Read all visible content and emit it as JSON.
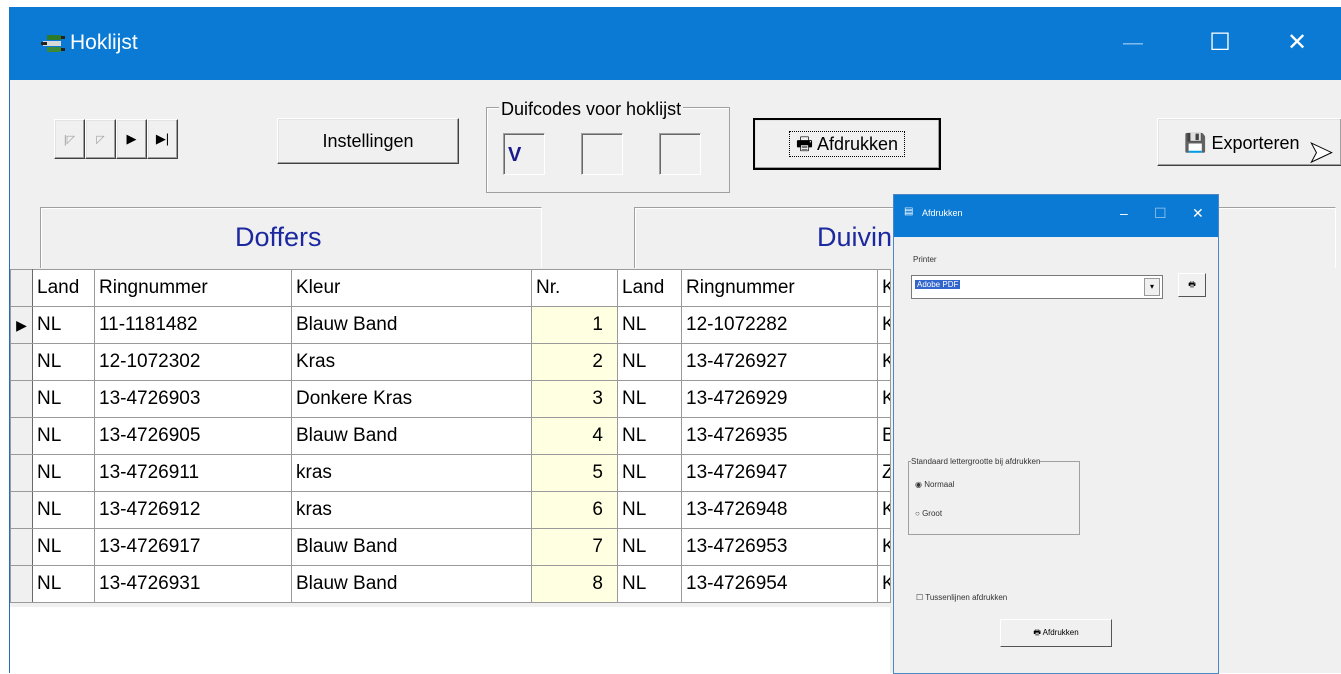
{
  "window": {
    "title": "Hoklijst",
    "controls": {
      "minimize": "—",
      "maximize": "☐",
      "close": "✕"
    }
  },
  "toolbar": {
    "nav_first": "⏮",
    "nav_prev": "◀",
    "nav_next": "▶",
    "nav_last": "▶|",
    "instellingen_label": "Instellingen",
    "afdrukken_label": "Afdrukken",
    "exporteren_label": "Exporteren"
  },
  "duifcodes": {
    "legend": "Duifcodes voor hoklijst",
    "codes": [
      "V",
      "",
      ""
    ]
  },
  "panels": {
    "doffers": "Doffers",
    "duivinnen": "Duivinn"
  },
  "table": {
    "headers": [
      "Land",
      "Ringnummer",
      "Kleur",
      "Nr.",
      "Land",
      "Ringnummer",
      "K"
    ],
    "rows": [
      {
        "land1": "NL",
        "ring1": "11-1181482",
        "kleur1": "Blauw Band",
        "nr": "1",
        "land2": "NL",
        "ring2": "12-1072282",
        "k2": "K"
      },
      {
        "land1": "NL",
        "ring1": "12-1072302",
        "kleur1": "Kras",
        "nr": "2",
        "land2": "NL",
        "ring2": "13-4726927",
        "k2": "K"
      },
      {
        "land1": "NL",
        "ring1": "13-4726903",
        "kleur1": "Donkere Kras",
        "nr": "3",
        "land2": "NL",
        "ring2": "13-4726929",
        "k2": "K"
      },
      {
        "land1": "NL",
        "ring1": "13-4726905",
        "kleur1": "Blauw Band",
        "nr": "4",
        "land2": "NL",
        "ring2": "13-4726935",
        "k2": "B"
      },
      {
        "land1": "NL",
        "ring1": "13-4726911",
        "kleur1": "kras",
        "nr": "5",
        "land2": "NL",
        "ring2": "13-4726947",
        "k2": "Z"
      },
      {
        "land1": "NL",
        "ring1": "13-4726912",
        "kleur1": "kras",
        "nr": "6",
        "land2": "NL",
        "ring2": "13-4726948",
        "k2": "K"
      },
      {
        "land1": "NL",
        "ring1": "13-4726917",
        "kleur1": "Blauw Band",
        "nr": "7",
        "land2": "NL",
        "ring2": "13-4726953",
        "k2": "K"
      },
      {
        "land1": "NL",
        "ring1": "13-4726931",
        "kleur1": "Blauw Band",
        "nr": "8",
        "land2": "NL",
        "ring2": "13-4726954",
        "k2": "K"
      }
    ]
  },
  "print_dialog": {
    "title": "Afdrukken",
    "printer_label": "Printer",
    "printer_value": "Adobe PDF",
    "font_group": "Standaard lettergrootte bij afdrukken",
    "opt_normaal": "Normaal",
    "opt_groot": "Groot",
    "checkbox_label": "Tussenlijnen afdrukken",
    "print_button": "Afdrukken"
  },
  "colors": {
    "titlebar": "#0a7ad4",
    "panel_header_text": "#1c28a0",
    "nr_column_bg": "#ffffe1"
  }
}
